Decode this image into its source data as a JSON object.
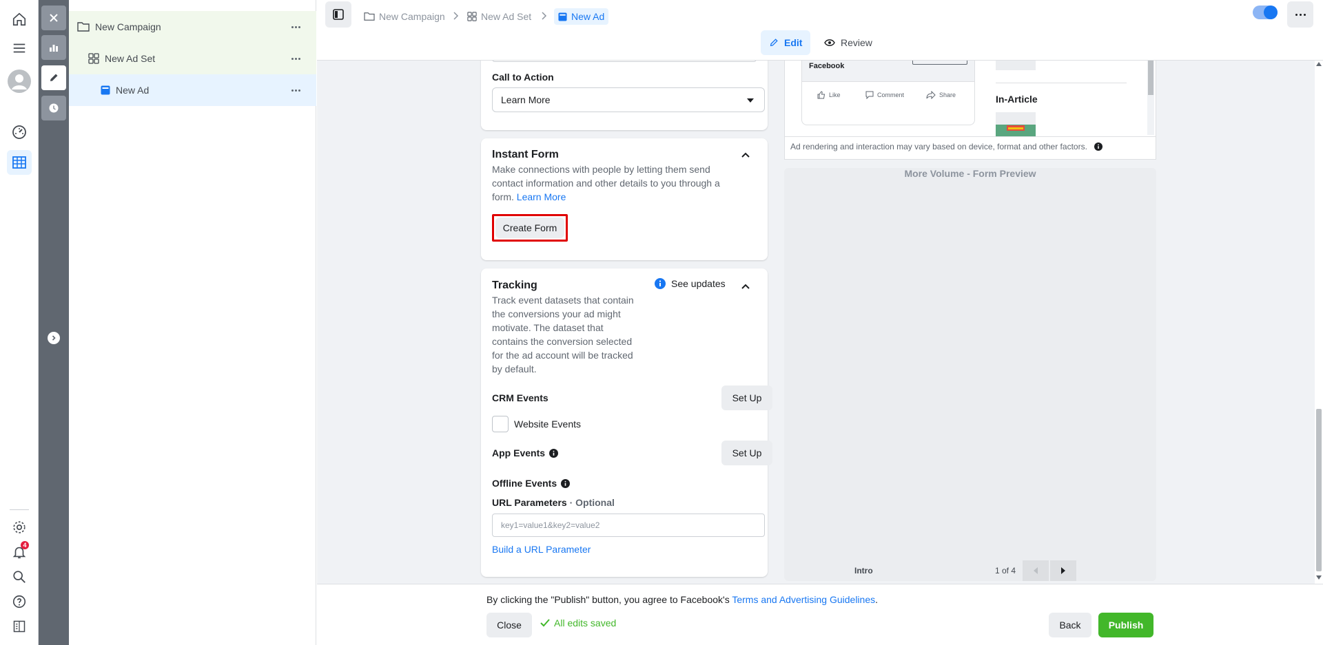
{
  "nav": {
    "notifications_count": "4"
  },
  "tree": {
    "campaign": "New Campaign",
    "adset": "New Ad Set",
    "ad": "New Ad"
  },
  "breadcrumb": {
    "campaign": "New Campaign",
    "adset": "New Ad Set",
    "ad": "New Ad"
  },
  "tabs": {
    "edit": "Edit",
    "review": "Review"
  },
  "cta": {
    "label": "Call to Action",
    "value": "Learn More"
  },
  "instant_form": {
    "title": "Instant Form",
    "description": "Make connections with people by letting them send contact information and other details to you through a form.",
    "learn_more": "Learn More",
    "create_button": "Create Form"
  },
  "tracking": {
    "title": "Tracking",
    "see_updates": "See updates",
    "description": "Track event datasets that contain the conversions your ad might motivate. The dataset that contains the conversion selected for the ad account will be tracked by default.",
    "crm_events": "CRM Events",
    "setup_label": "Set Up",
    "website_events": "Website Events",
    "app_events": "App Events",
    "offline_events": "Offline Events",
    "url_params_label": "URL Parameters",
    "url_params_optional": " · Optional",
    "url_params_placeholder": "key1=value1&key2=value2",
    "build_url": "Build a URL Parameter"
  },
  "preview": {
    "page_name": "Facebook",
    "like": "Like",
    "comment": "Comment",
    "share": "Share",
    "placement": "In-Article",
    "note": "Ad rendering and interaction may vary based on device, format and other factors.",
    "form_title": "More Volume - Form Preview",
    "step_label": "Intro",
    "page_counter": "1 of 4"
  },
  "footer": {
    "disclaimer_prefix": "By clicking the \"Publish\" button, you agree to Facebook's ",
    "disclaimer_link": "Terms and Advertising Guidelines",
    "disclaimer_suffix": ".",
    "close": "Close",
    "saved": "All edits saved",
    "back": "Back",
    "publish": "Publish"
  },
  "colors": {
    "accent": "#1877f2",
    "publish_green": "#42b72a",
    "highlight_red": "#e00000",
    "tree_selected": "#e7f3ff",
    "tree_parent": "#f1f8ec"
  }
}
